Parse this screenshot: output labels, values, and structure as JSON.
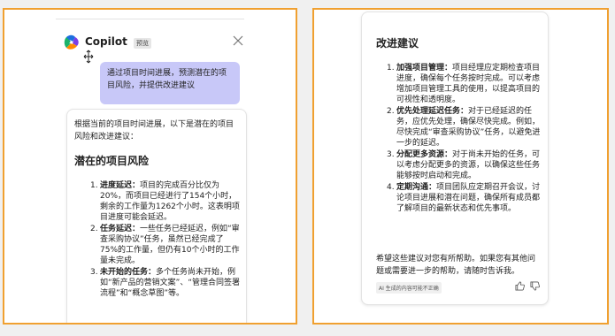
{
  "left_panel": {
    "app_name": "Copilot",
    "badge": "预览",
    "user_message": "通过项目时间进展，预测潜在的项目风险，并提供改进建议",
    "response_intro": "根据当前的项目时间进展，以下是潜在的项目风险和改进建议：",
    "section_heading": "潜在的项目风险",
    "risks": [
      {
        "num": "1.",
        "title": "进度延迟：",
        "text": "项目的完成百分比仅为20%，而项目已经进行了154个小时，剩余的工作量为1262个小时。这表明项目进度可能会延迟。"
      },
      {
        "num": "2.",
        "title": "任务延迟：",
        "text": "一些任务已经延迟，例如“审查采购协议”任务，虽然已经完成了75%的工作量，但仍有10个小时的工作量未完成。"
      },
      {
        "num": "3.",
        "title": "未开始的任务：",
        "text": "多个任务尚未开始，例如“新产品的营销文案”、“管理合同签署流程”和“概念草图”等。"
      }
    ]
  },
  "right_panel": {
    "section_heading": "改进建议",
    "suggestions": [
      {
        "num": "1.",
        "title": "加强项目管理：",
        "text": "项目经理应定期检查项目进度，确保每个任务按时完成。可以考虑增加项目管理工具的使用，以提高项目的可视性和透明度。"
      },
      {
        "num": "2.",
        "title": "优先处理延迟任务：",
        "text": "对于已经延迟的任务，应优先处理，确保尽快完成。例如，尽快完成“审查采购协议”任务，以避免进一步的延迟。"
      },
      {
        "num": "3.",
        "title": "分配更多资源：",
        "text": "对于尚未开始的任务，可以考虑分配更多的资源，以确保这些任务能够按时启动和完成。"
      },
      {
        "num": "4.",
        "title": "定期沟通：",
        "text": "项目团队应定期召开会议，讨论项目进展和潜在问题，确保所有成员都了解项目的最新状态和优先事项。"
      }
    ],
    "closing": "希望这些建议对您有所帮助。如果您有其他问题或需要进一步的帮助，请随时告诉我。",
    "disclaimer": "AI 生成的内容可能不正确"
  },
  "colors": {
    "frame_border": "#f0a030",
    "user_bubble": "#c8c8f8"
  },
  "icons": [
    "copilot-logo-icon",
    "close-icon",
    "pointer-cursor-icon",
    "thumbs-up-icon",
    "thumbs-down-icon"
  ]
}
